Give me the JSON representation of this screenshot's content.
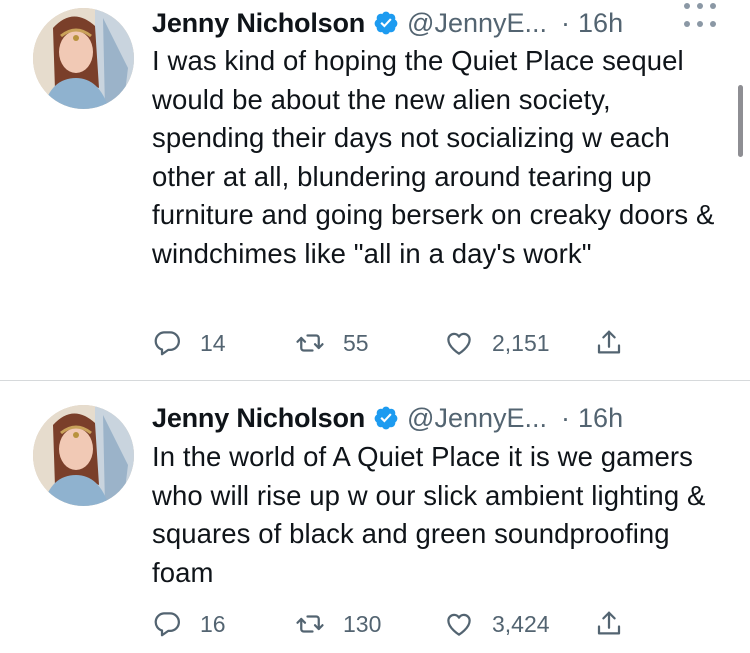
{
  "tweets": [
    {
      "name": "Jenny Nicholson",
      "handle": "@JennyE...",
      "separator": "·",
      "time": "16h",
      "text": "I was kind of hoping the Quiet Place sequel would be about the new alien society, spending their days not socializing w each other at all, blundering around tearing up furniture and going berserk on creaky doors & windchimes like \"all in a day's work\"",
      "replies": "14",
      "retweets": "55",
      "likes": "2,151"
    },
    {
      "name": "Jenny Nicholson",
      "handle": "@JennyE...",
      "separator": "·",
      "time": "16h",
      "text": "In the world of A Quiet Place it is we gamers who will rise up w our slick ambient lighting & squares of black and green soundproofing foam",
      "replies": "16",
      "retweets": "130",
      "likes": "3,424"
    }
  ],
  "colors": {
    "verified": "#1d9bf0",
    "secondary_text": "#536471",
    "divider": "#d6d9db"
  },
  "icons": [
    "verified-badge-icon",
    "more-options-icon",
    "reply-icon",
    "retweet-icon",
    "like-icon",
    "share-icon"
  ]
}
